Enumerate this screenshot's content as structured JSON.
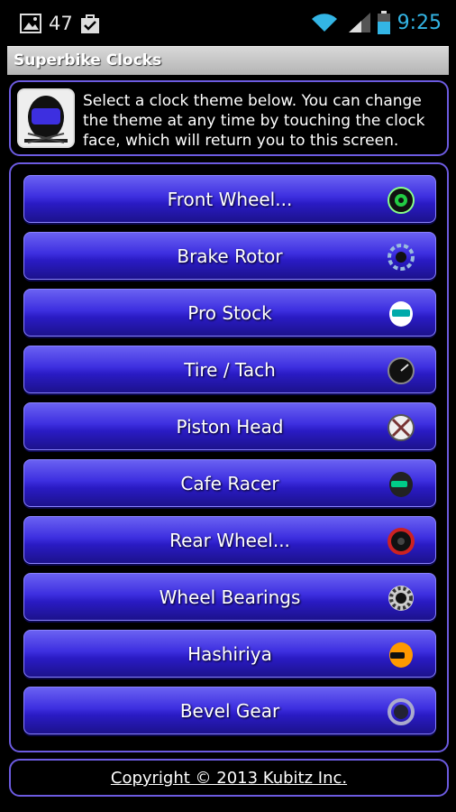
{
  "status_bar": {
    "notification_count": "47",
    "time": "9:25",
    "icons": [
      "picture-icon",
      "checked-bag-icon",
      "wifi-icon",
      "signal-icon",
      "battery-icon"
    ],
    "time_color": "#33b5e5"
  },
  "titlebar": {
    "title": "Superbike Clocks"
  },
  "info": {
    "icon": "helmet-icon",
    "text": "Select a clock theme below. You can change the theme at any time by touching the clock face, which will return you to this screen."
  },
  "themes": [
    {
      "label": "Front Wheel...",
      "icon": "front-wheel-icon"
    },
    {
      "label": "Brake Rotor",
      "icon": "brake-rotor-icon"
    },
    {
      "label": "Pro Stock",
      "icon": "pro-stock-helmet-icon"
    },
    {
      "label": "Tire / Tach",
      "icon": "tachometer-icon"
    },
    {
      "label": "Piston Head",
      "icon": "piston-head-icon"
    },
    {
      "label": "Cafe Racer",
      "icon": "cafe-racer-helmet-icon"
    },
    {
      "label": "Rear Wheel...",
      "icon": "rear-wheel-icon"
    },
    {
      "label": "Wheel Bearings",
      "icon": "wheel-bearing-icon"
    },
    {
      "label": "Hashiriya",
      "icon": "hashiriya-helmet-icon"
    },
    {
      "label": "Bevel Gear",
      "icon": "bevel-gear-icon"
    }
  ],
  "footer": {
    "copyright": "Copyright © 2013 Kubitz Inc."
  },
  "colors": {
    "accent_border": "#6c5be0",
    "button": "#3d2fe0"
  }
}
